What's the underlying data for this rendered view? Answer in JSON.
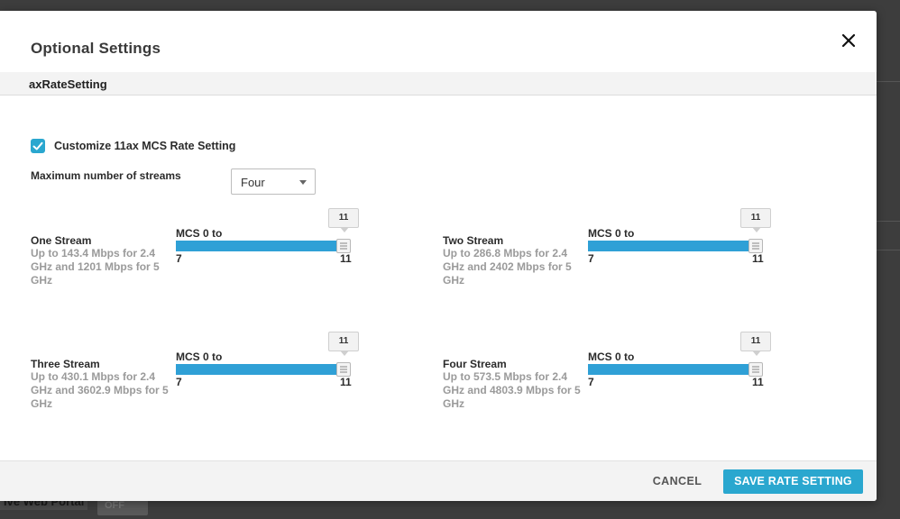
{
  "backdrop": {
    "portal_label": "ive Web Portal",
    "toggle_label": "OFF"
  },
  "modal": {
    "title": "Optional Settings",
    "section": "axRateSetting",
    "customize": {
      "label": "Customize 11ax MCS Rate Setting",
      "checked": true
    },
    "streams": {
      "label": "Maximum number of streams",
      "selected": "Four"
    },
    "stream_settings": [
      {
        "title": "One Stream",
        "description": "Up to 143.4 Mbps for 2.4 GHz and 1201 Mbps for 5 GHz",
        "mcs_label": "MCS 0 to",
        "min": "7",
        "max": "11",
        "value": "11"
      },
      {
        "title": "Two Stream",
        "description": "Up to 286.8 Mbps for 2.4 GHz and 2402 Mbps for 5 GHz",
        "mcs_label": "MCS 0 to",
        "min": "7",
        "max": "11",
        "value": "11"
      },
      {
        "title": "Three Stream",
        "description": "Up to 430.1 Mbps for 2.4 GHz and 3602.9 Mbps for 5 GHz",
        "mcs_label": "MCS 0 to",
        "min": "7",
        "max": "11",
        "value": "11"
      },
      {
        "title": "Four Stream",
        "description": "Up to 573.5 Mbps for 2.4 GHz and 4803.9 Mbps for 5 GHz",
        "mcs_label": "MCS 0 to",
        "min": "7",
        "max": "11",
        "value": "11"
      }
    ],
    "footer": {
      "cancel_label": "CANCEL",
      "save_label": "SAVE RATE SETTING"
    }
  },
  "colors": {
    "accent": "#2aa7cf",
    "slider": "#2fa0d6",
    "muted_text": "#9a9a9a"
  }
}
